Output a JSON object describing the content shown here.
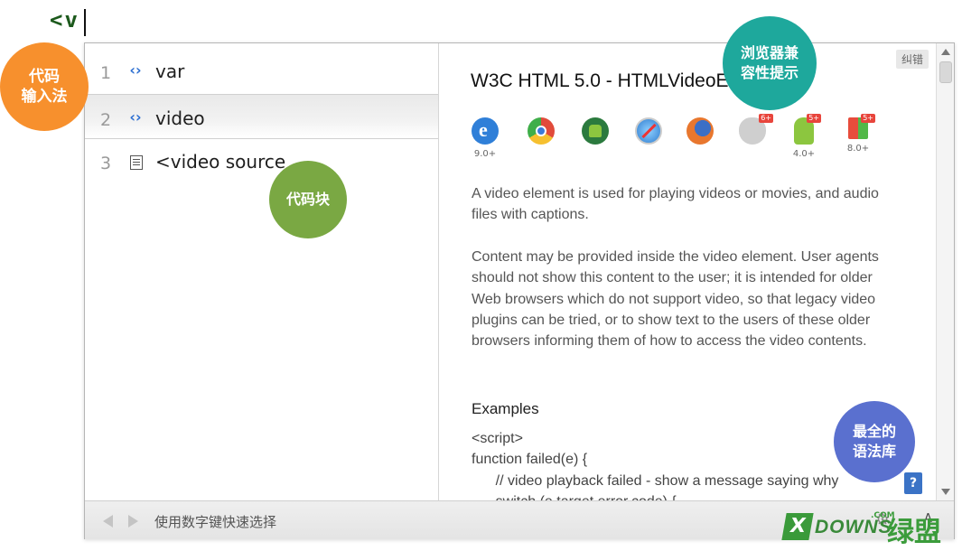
{
  "editor": {
    "typed_text": "<v"
  },
  "suggestions": [
    {
      "num": "1",
      "label": "var",
      "icon": "tag-icon"
    },
    {
      "num": "2",
      "label": "video",
      "icon": "tag-icon"
    },
    {
      "num": "3",
      "label": "<video source",
      "icon": "snippet-icon"
    }
  ],
  "detail": {
    "title": "W3C HTML 5.0 - HTMLVideoElement",
    "report_label": "纠错",
    "browsers": [
      {
        "icon": "ie-icon",
        "version": "9.0+",
        "color": "#2f7fd8"
      },
      {
        "icon": "chrome-icon",
        "version": "",
        "color": "#e14b3b"
      },
      {
        "icon": "android-browser-icon",
        "version": "",
        "color": "#3fae49"
      },
      {
        "icon": "safari-icon",
        "version": "",
        "color": "#4a9be0"
      },
      {
        "icon": "firefox-icon",
        "version": "",
        "color": "#e8772e"
      },
      {
        "icon": "ios-safari-icon",
        "version": "",
        "badge": "6+",
        "color": "#cfcfcf"
      },
      {
        "icon": "android-icon",
        "version": "4.0+",
        "badge": "5+",
        "color": "#8cc63f"
      },
      {
        "icon": "windows-phone-icon",
        "version": "8.0+",
        "badge": "5+",
        "color": "#52b848"
      }
    ],
    "paragraph1": "A video element is used for playing videos or movies, and audio files with captions.",
    "paragraph2": "Content may be provided inside the video element. User agents should not show this content to the user; it is intended for older Web browsers which do not support video, so that legacy video plugins can be tried, or to show text to the users of these older browsers informing them of how to access the video contents.",
    "examples_heading": "Examples",
    "code": "<script>\nfunction failed(e) {\n      // video playback failed - show a message saying why\n      switch (e.target.error.code) {",
    "help_label": "?"
  },
  "footer": {
    "hint": "使用数字键快速选择",
    "font_label": "A"
  },
  "callouts": {
    "input_method": "代码\n输入法",
    "compat": "浏览器兼\n容性提示",
    "snippet": "代码块",
    "library": "最全的\n语法库"
  },
  "watermark": {
    "x": "X",
    "downs": "DOWNS",
    "com": ".COM",
    "cn": "绿盟"
  },
  "colors": {
    "orange": "#f7902d",
    "teal": "#1ea89c",
    "green": "#7aa843",
    "blue": "#5a70cf"
  }
}
